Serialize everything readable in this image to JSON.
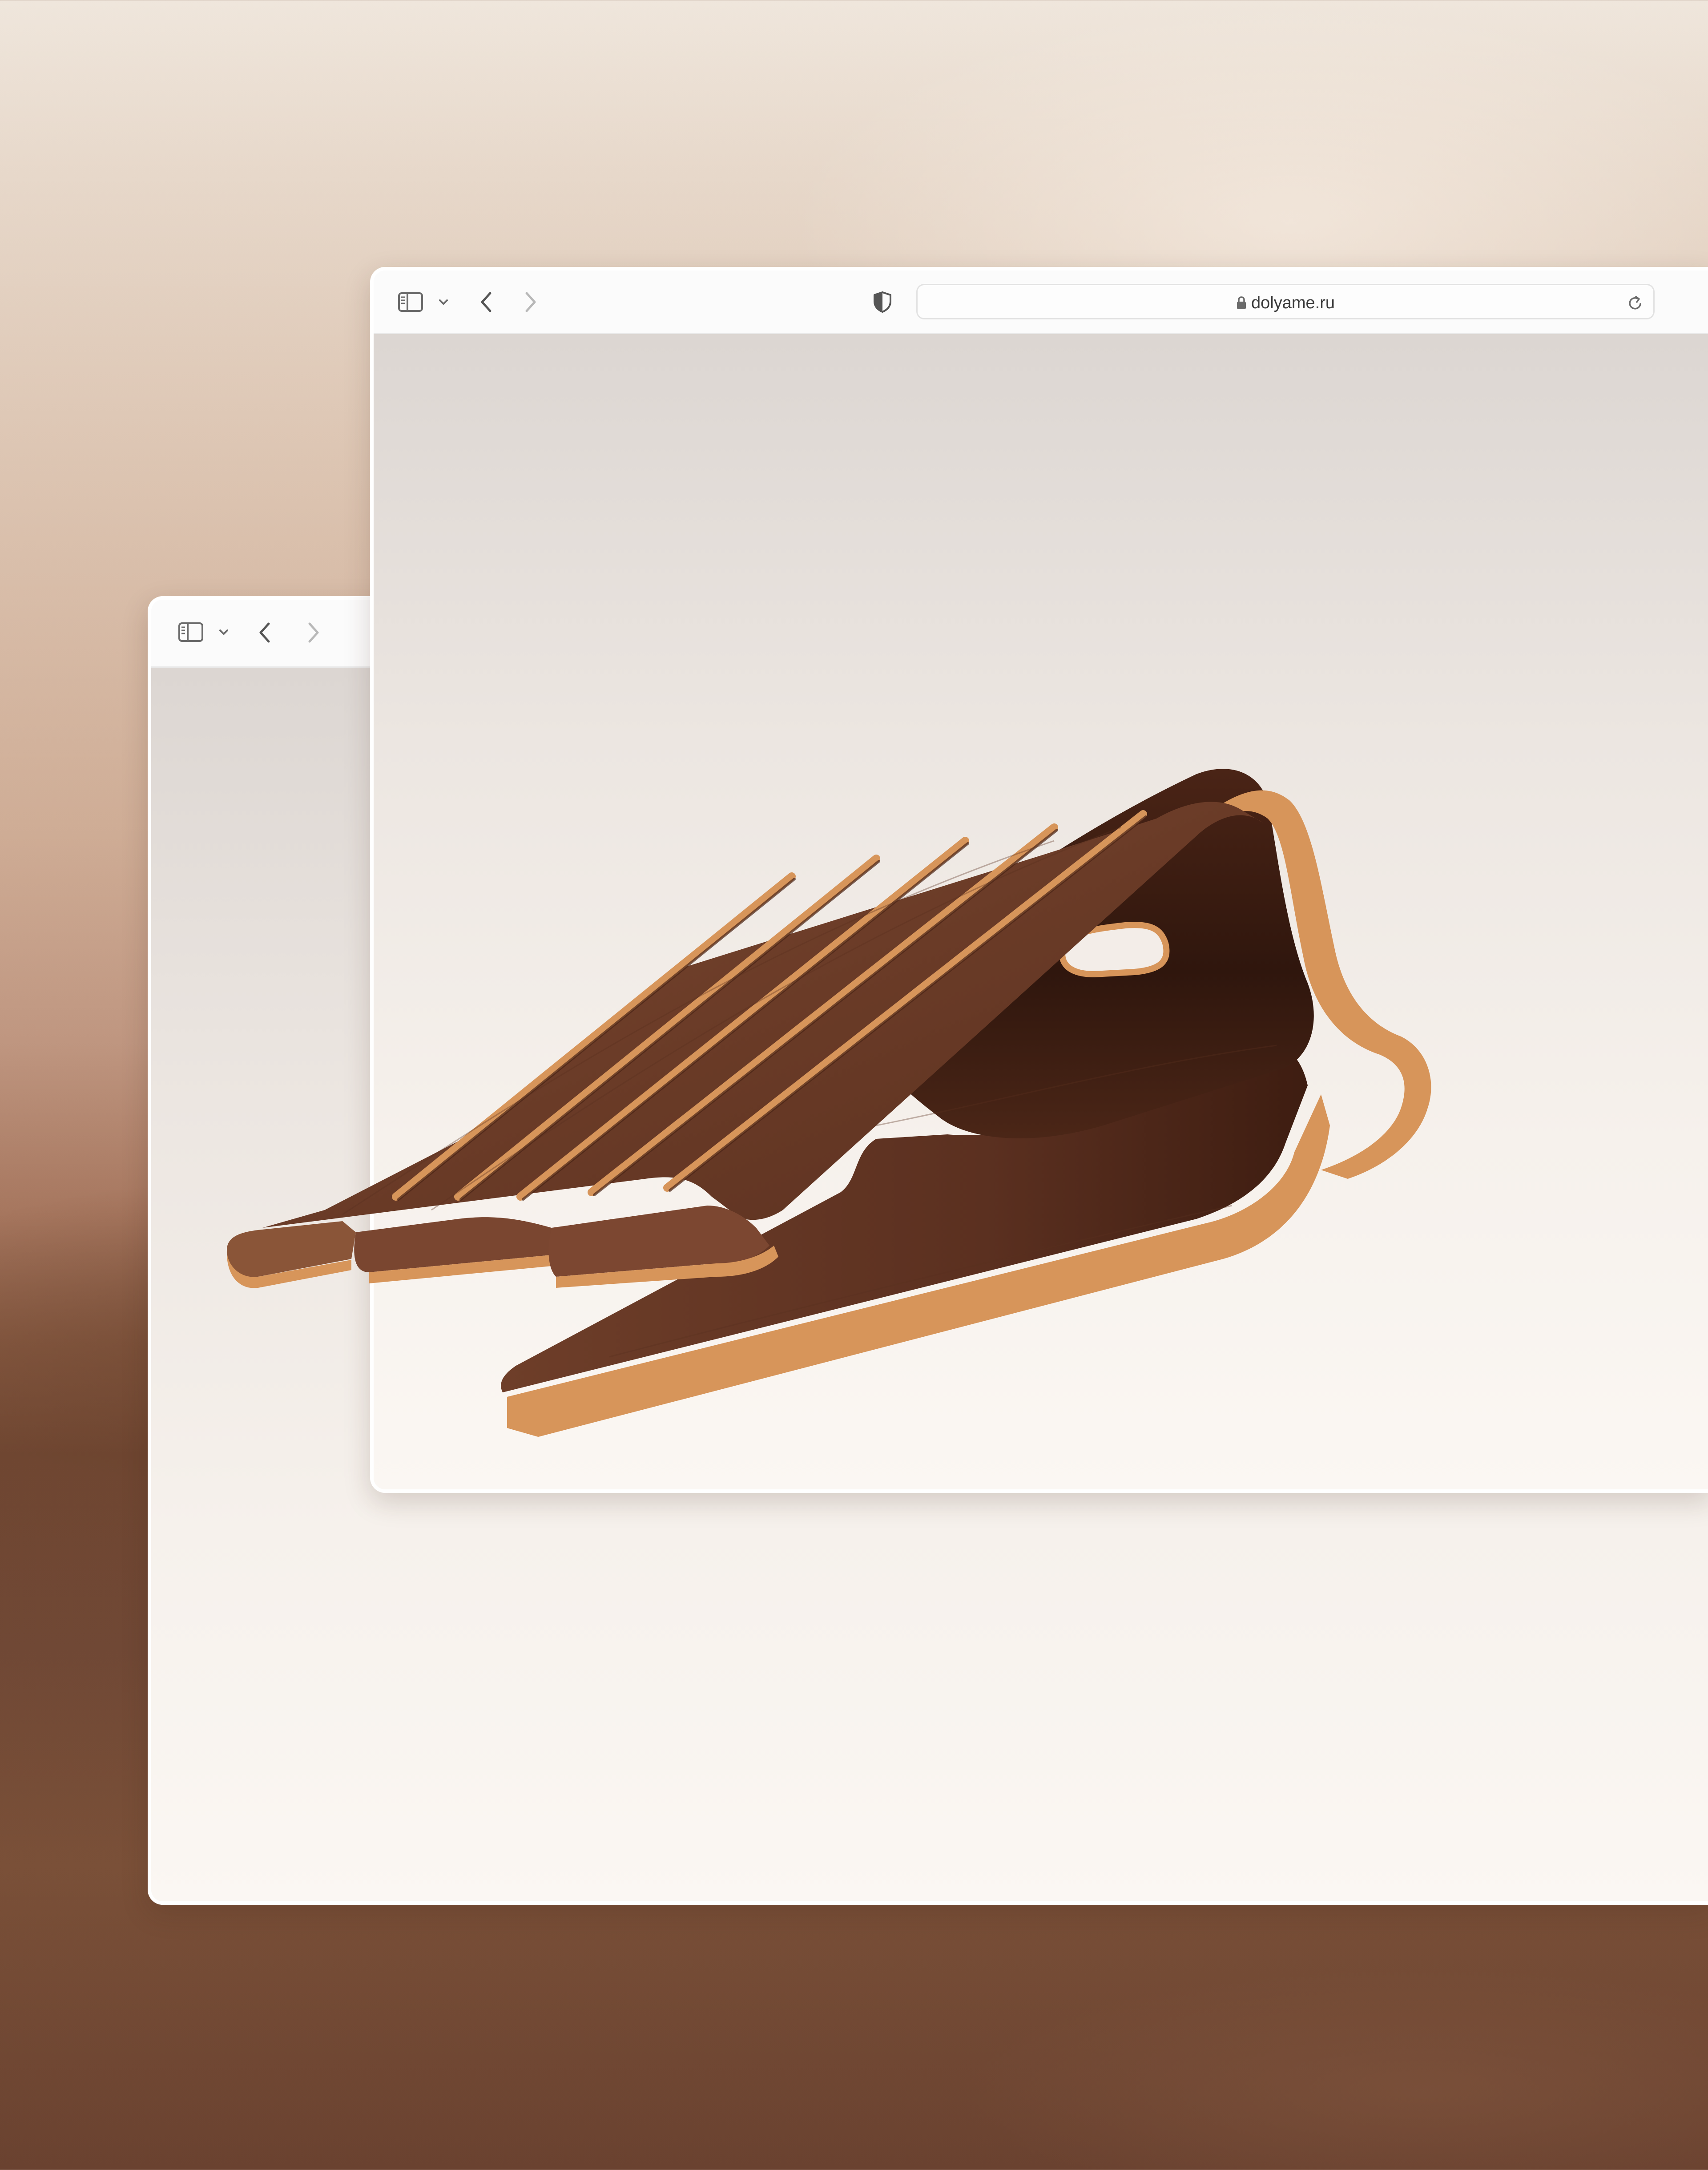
{
  "front_window": {
    "toolbar": {
      "sidebar_toggle_icon": "sidebar-icon",
      "sidebar_menu_icon": "chevron-down-icon",
      "back_icon": "chevron-left-icon",
      "forward_icon": "chevron-right-icon",
      "privacy_icon": "shield-icon",
      "lock_icon": "lock-icon",
      "reload_icon": "reload-icon"
    },
    "address_bar": {
      "url": "dolyame.ru"
    }
  },
  "back_window": {
    "toolbar": {
      "sidebar_toggle_icon": "sidebar-icon",
      "sidebar_menu_icon": "chevron-down-icon",
      "back_icon": "chevron-left-icon",
      "forward_icon": "chevron-right-icon"
    }
  },
  "product_image": {
    "subject": "laptop-stand",
    "material_colors": {
      "walnut": "#5a2e1c",
      "walnut_light": "#7a4630",
      "plywood_edge": "#d7955a"
    }
  },
  "colors": {
    "window_chrome": "#fbfbfb",
    "window_border": "#ffffff",
    "icon": "#6b6b6b",
    "icon_disabled": "#b8b8b8"
  }
}
